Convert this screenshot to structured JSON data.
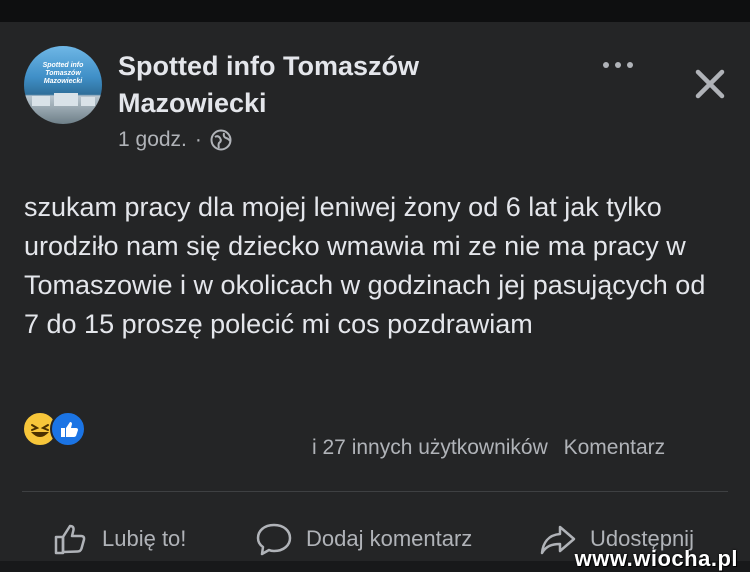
{
  "post": {
    "author": "Spotted info Tomaszów Mazowiecki",
    "avatar_text": "Spotted info Tomaszów Mazowiecki",
    "time": "1 godz.",
    "separator": "·",
    "privacy_icon": "globe-icon",
    "text": "szukam pracy dla mojej leniwej żony od 6 lat jak tylko urodziło nam się dziecko wmawia mi ze nie ma pracy w Tomaszowie i w okolicach w godzinach jej pasujących od 7 do 15 proszę polecić mi cos pozdrawiam"
  },
  "reactions": {
    "icons": [
      "haha-icon",
      "like-icon"
    ],
    "summary": "i 27 innych użytkowników",
    "comments_label": "Komentarz"
  },
  "actions": {
    "like": "Lubię to!",
    "comment": "Dodaj komentarz",
    "share": "Udostępnij"
  },
  "watermark": "www.wiocha.pl",
  "colors": {
    "background": "#18191a",
    "card": "#242526",
    "text": "#e4e6eb",
    "secondary": "#b0b3b8",
    "haha": "#f7c63a",
    "like": "#1b74e4"
  }
}
